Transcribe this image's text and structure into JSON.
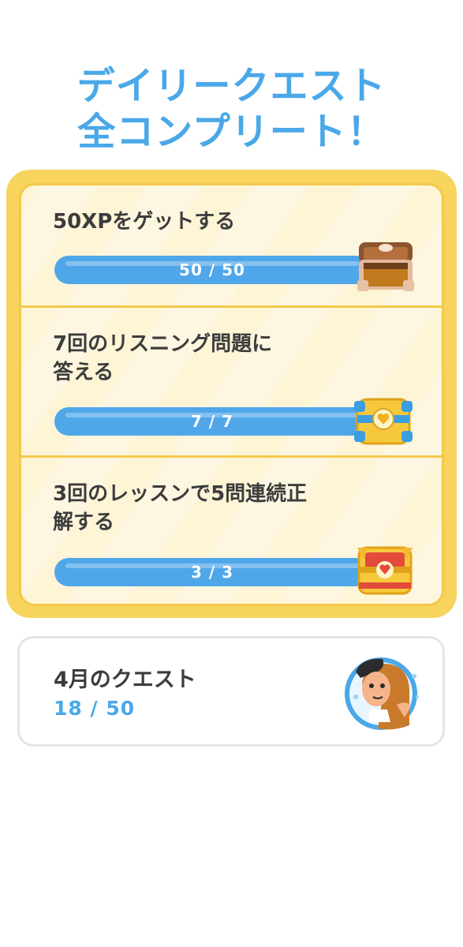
{
  "header": {
    "title_line1": "デイリークエスト",
    "title_line2": "全コンプリート！"
  },
  "quests": [
    {
      "title_line1": "50XPをゲットする",
      "title_line2": "",
      "progress_text": "50 / 50",
      "current": 50,
      "total": 50,
      "reward_icon": "chest-open-wood-icon"
    },
    {
      "title_line1": "7回のリスニング問題に",
      "title_line2": "答える",
      "progress_text": "7 / 7",
      "current": 7,
      "total": 7,
      "reward_icon": "chest-gold-heart-icon"
    },
    {
      "title_line1": "3回のレッスンで5問連続正",
      "title_line2": "解する",
      "progress_text": "3 / 3",
      "current": 3,
      "total": 3,
      "reward_icon": "chest-gold-red-icon"
    }
  ],
  "monthly": {
    "title": "4月のクエスト",
    "progress_text": "18 / 50",
    "current": 18,
    "total": 50,
    "avatar_icon": "character-avatar-icon"
  },
  "colors": {
    "accent_blue": "#4aa8e8",
    "bar_blue": "#4fa7ea",
    "gold": "#f7d45c",
    "panel_bg": "#fdf6e0"
  }
}
